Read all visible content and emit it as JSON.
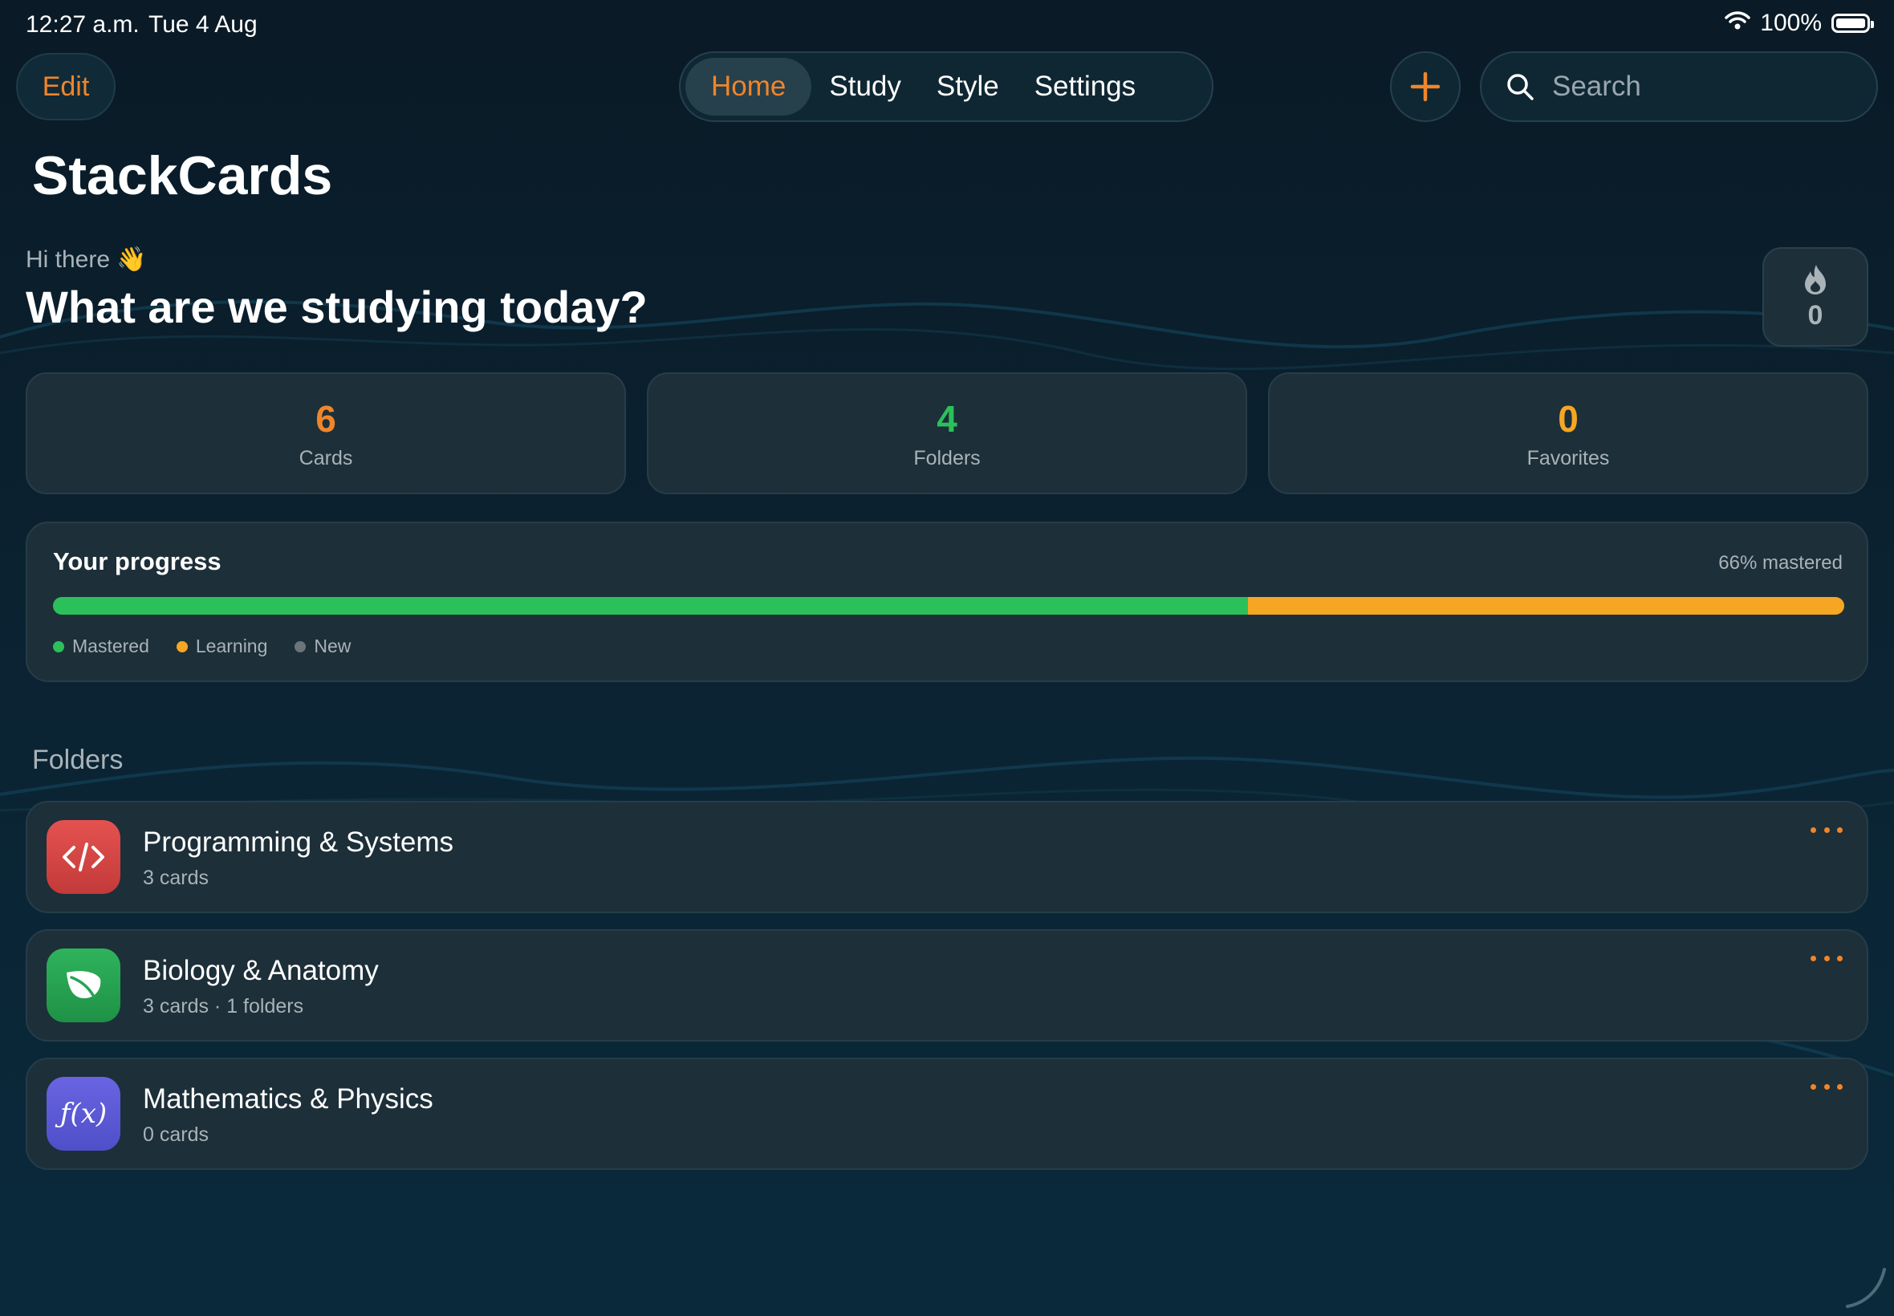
{
  "status": {
    "time": "12:27 a.m.",
    "date": "Tue 4 Aug",
    "battery": "100%"
  },
  "toolbar": {
    "edit_label": "Edit",
    "tabs": [
      {
        "label": "Home",
        "active": true
      },
      {
        "label": "Study",
        "active": false
      },
      {
        "label": "Style",
        "active": false
      },
      {
        "label": "Settings",
        "active": false
      }
    ],
    "search_placeholder": "Search"
  },
  "app_title": "StackCards",
  "greeting": "Hi there 👋",
  "headline": "What are we studying today?",
  "streak": {
    "count": "0",
    "icon": "flame-icon"
  },
  "stats": [
    {
      "value": "6",
      "label": "Cards",
      "color": "#f0852b"
    },
    {
      "value": "4",
      "label": "Folders",
      "color": "#2cc05a"
    },
    {
      "value": "0",
      "label": "Favorites",
      "color": "#f5a623"
    }
  ],
  "progress": {
    "title": "Your progress",
    "summary": "66% mastered",
    "mastered_fraction": 0.667,
    "learning_fraction": 0.333,
    "new_fraction": 0.0,
    "legend": [
      {
        "label": "Mastered",
        "color": "#2cc05a"
      },
      {
        "label": "Learning",
        "color": "#f5a623"
      },
      {
        "label": "New",
        "color": "#6b7479"
      }
    ]
  },
  "folders_title": "Folders",
  "folders": [
    {
      "name": "Programming & Systems",
      "meta": "3 cards",
      "icon": "code-icon",
      "color": "#d94545"
    },
    {
      "name": "Biology & Anatomy",
      "meta": "3 cards · 1 folders",
      "icon": "leaf-icon",
      "color": "#27a452"
    },
    {
      "name": "Mathematics & Physics",
      "meta": "0 cards",
      "icon": "function-icon",
      "color": "#5b5bd6",
      "icon_text": "ƒ(x)"
    }
  ],
  "colors": {
    "accent": "#f0852b",
    "card_bg": "#1d2f39",
    "background": "#0b2231"
  }
}
